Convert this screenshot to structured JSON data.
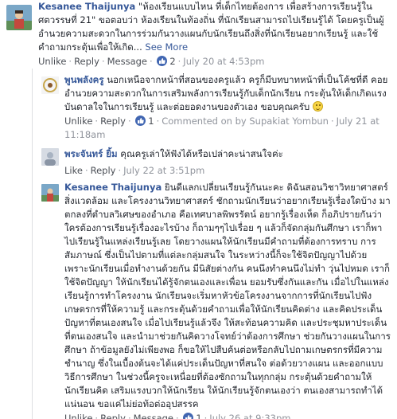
{
  "comments": [
    {
      "author": "Kesanee Thaijunya",
      "text": "\"ห้องเรียนแบบไหน ที่เด็กไทยต้องการ เพื่อสร้างการเรียนรู้ใน ศตวรรษที่ 21\" ขอตอบว่า ห้องเรียนในท้องถิ่น ที่นักเรียนสามารถไปเรียนรู้ได้ โดยครูเป็นผู้อำนวยความสะดวกในการร่วมกันวางแผนกับนักเรียนถึงสิ่งที่นักเรียนอยากเรียนรู้ และใช้คำถามกระตุ้นเพื่อให้เกิด...",
      "see_more": "See More",
      "actions": {
        "like": "Unlike",
        "reply": "Reply",
        "message": "Message"
      },
      "likes": "2",
      "time": "July 20 at 4:53pm"
    },
    {
      "author": "พูนพลังครู",
      "text": "นอกเหนือจากหน้าที่สอนของครูแล้ว ครูก็มีบทบาทหน้าที่เป็นโค้ชที่ดี คอยอำนวยความสะดวกในการเสริมพลังการเรียนรู้กับเด็กนักเรียน กระตุ้นให้เด็กเกิดแรงบันดาลใจในการเรียนรู้ และต่อยอดงานของตัวเอง ขอบคุณครับ",
      "actions": {
        "like": "Unlike",
        "reply": "Reply"
      },
      "likes": "1",
      "commented_on": "Commented on by Supakiat Yombun",
      "time": "July 21 at 11:18am"
    },
    {
      "author": "พระจันทร์ ยิ้ม",
      "text": "คุณครูเล่าให้ฟังได้หรือเปล่าคะน่าสนใจค่ะ",
      "actions": {
        "like": "Like",
        "reply": "Reply"
      },
      "time": "July 22 at 3:51pm"
    },
    {
      "author": "Kesanee Thaijunya",
      "text": "ยินดีแลกเปลี่ยนเรียนรู้กันนะคะ ดิฉันสอนวิชาวิทยาศาสตร์สิ่งแวดล้อม และโครงงานวิทยาศาสตร์ ชักถามนักเรียนว่าอยากเรียนรู้เรื่องใดบ้าง มาตกลงที่ตำบลวิเศษของอำเภอ คือเทศบาลพิพรรัตน์ อยากรู้เรื่องเห็ด ก็อภิปรายกันว่าใครต้องการเรียนรู้เรื่องอะไรบ้าง ก็ถามๆๆไปเรื่อย ๆ แล้วก็จัดกลุ่มกันศึกษา เราก็พาไปเรียนรู้ในแหล่งเรียนรู้เลย โดยวางแผนให้นักเรียนมีคำถามที่ต้องการทราบ การสัมภาษณ์ ซึ่งเป็นไปตามที่แต่ละกลุ่มสนใจ ในระหว่างนี้ก็จะใช้จิตปัญญาไปด้วย เพราะนักเรียนเมื่อทำงานด้วยกัน มีนิสัยต่างกัน คนนึงทำคนนึงไม่ทำ วุ่นไปหมด เราก็ใช้จิตปัญญา ให้นักเรียนได้รู้จักตนเองและเพื่อน ยอมรับซึ่งกันและกัน เมื่อไปในแหล่งเรียนรู้การทำโครงงาน นักเรียนจะเริ่มหาหัวข้อโครงงานจากการที่นักเรียนไปฟังเกษตรกรที่ให้ความรู้ และกระตุ้นด้วยคำถามเพื่อให้นักเรียนคิดต่าง และคิดประเด็นปัญหาที่ตนเองสนใจ เมื่อไปเรียนรู้แล้วจึง ให้สะท้อนความคิด และประชุมหาประเด็นที่ตนเองสนใจ และนำมาช่วยกันคิดวางโจทย์ว่าต้องการศึกษา ช่วยกันวางแผนในการศึกษา ถ้าข้อมูลยังไม่เพียงพอ ก็ขอให้ไปสืบค้นต่อหรือกลับไปถามเกษตรกรที่มีความชำนาญ ซึ่งในเบื้องต้นจะได้แค่ประเด็นปัญหาที่สนใจ ต่อด้วยวางแผน และออกแบบวิธีการศึกษา ในช่วงนี้ครูจะเหนื่อยที่ต้องซักถามในทุกกลุ่ม กระตุ้นด้วยคำถามให้นักเรียนคิด เสริมแรงบวกให้นักเรียน ให้นักเรียนรู้จักตนเองว่า ตนเองสามารถทำได้แน่นอน ขอแค่ไม่ย่อท้อต่ออุปสรรค",
      "actions": {
        "like": "Unlike",
        "reply": "Reply",
        "message": "Message"
      },
      "likes": "1",
      "time": "July 26 at 9:33pm"
    }
  ],
  "colors": {
    "link": "#365899",
    "meta": "#90949c",
    "like_badge": "#4267b2"
  }
}
